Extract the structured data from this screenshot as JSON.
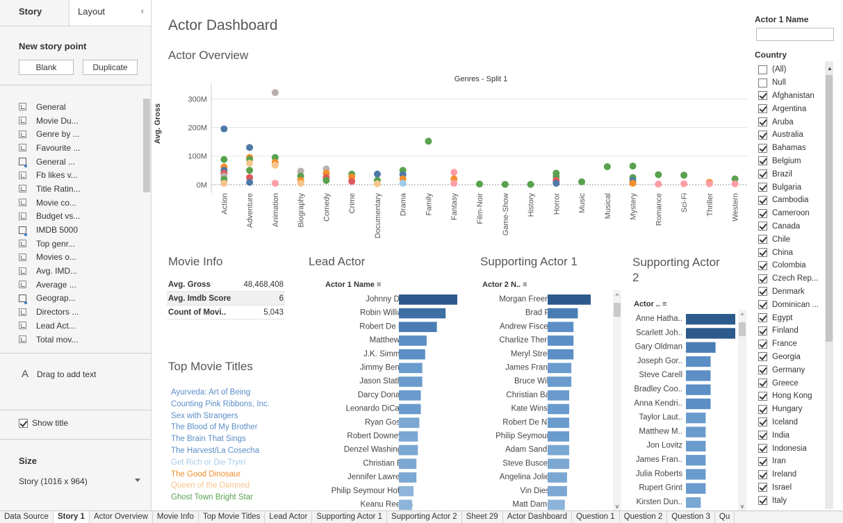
{
  "story_panel": {
    "tab_story": "Story",
    "tab_layout": "Layout",
    "new_story_point": "New story point",
    "blank_button": "Blank",
    "duplicate_button": "Duplicate",
    "sheets": [
      "General",
      "Movie Du...",
      "Genre by ...",
      "Favourite ...",
      "General ...",
      "Fb likes v...",
      "Title Ratin...",
      "Movie co...",
      "Budget vs...",
      "IMDB 5000",
      "Top genr...",
      "Movies o...",
      "Avg. IMD...",
      "Average ...",
      "Geograp...",
      "Directors ...",
      "Lead Act...",
      "Total mov..."
    ],
    "sheet_icons": [
      "chart",
      "chart",
      "chart",
      "chart",
      "dashboard",
      "chart",
      "chart",
      "chart",
      "chart",
      "dashboard",
      "chart",
      "chart",
      "chart",
      "chart",
      "dashboard",
      "chart",
      "chart",
      "chart"
    ],
    "drag_text": "Drag to add text",
    "show_title": "Show title",
    "size_label": "Size",
    "size_value": "Story (1016 x 964)"
  },
  "dashboard": {
    "title": "Actor Dashboard",
    "overview_title": "Actor Overview",
    "movie_info_title": "Movie Info",
    "lead_actor_title": "Lead Actor",
    "supporting1_title": "Supporting Actor 1",
    "supporting2_title": "Supporting Actor",
    "supporting2_title_line2": "2",
    "top_titles_title": "Top Movie Titles",
    "movie_info": [
      {
        "label": "Avg. Gross",
        "value": "48,468,408"
      },
      {
        "label": "Avg. Imdb Score",
        "value": "6"
      },
      {
        "label": "Count of Movi..",
        "value": "5,043"
      }
    ],
    "lead_header": "Actor 1 Name",
    "sup1_header": "Actor 2 N..",
    "sup2_header": "Actor ..",
    "top_titles": [
      {
        "text": "Ayurveda: Art of Being",
        "color": "#5b8ec7"
      },
      {
        "text": "Counting  Pink Ribbons, Inc.",
        "color": "#5b8ec7"
      },
      {
        "text": "Sex with Strangers",
        "color": "#5b8ec7"
      },
      {
        "text": "The Blood of My Brother",
        "color": "#5b8ec7"
      },
      {
        "text": "The Brain That Sings",
        "color": "#5b8ec7"
      },
      {
        "text": "The Harvest/La Cosecha",
        "color": "#5b8ec7"
      },
      {
        "text": "Get Rich or Die Tryin'",
        "color": "#a6cbe9"
      },
      {
        "text": "The Good Dinosaur",
        "color": "#f28e2b"
      },
      {
        "text": "Queen of the Damned",
        "color": "#f7c58b"
      },
      {
        "text": "Ghost Town  Bright Star",
        "color": "#59a14f"
      }
    ]
  },
  "filters": {
    "actor1_label": "Actor 1 Name",
    "country_label": "Country",
    "countries": [
      {
        "name": "(All)",
        "checked": false
      },
      {
        "name": "Null",
        "checked": false
      },
      {
        "name": "Afghanistan",
        "checked": true
      },
      {
        "name": "Argentina",
        "checked": true
      },
      {
        "name": "Aruba",
        "checked": true
      },
      {
        "name": "Australia",
        "checked": true
      },
      {
        "name": "Bahamas",
        "checked": true
      },
      {
        "name": "Belgium",
        "checked": true
      },
      {
        "name": "Brazil",
        "checked": true
      },
      {
        "name": "Bulgaria",
        "checked": true
      },
      {
        "name": "Cambodia",
        "checked": true
      },
      {
        "name": "Cameroon",
        "checked": true
      },
      {
        "name": "Canada",
        "checked": true
      },
      {
        "name": "Chile",
        "checked": true
      },
      {
        "name": "China",
        "checked": true
      },
      {
        "name": "Colombia",
        "checked": true
      },
      {
        "name": "Czech Rep...",
        "checked": true
      },
      {
        "name": "Denmark",
        "checked": true
      },
      {
        "name": "Dominican ...",
        "checked": true
      },
      {
        "name": "Egypt",
        "checked": true
      },
      {
        "name": "Finland",
        "checked": true
      },
      {
        "name": "France",
        "checked": true
      },
      {
        "name": "Georgia",
        "checked": true
      },
      {
        "name": "Germany",
        "checked": true
      },
      {
        "name": "Greece",
        "checked": true
      },
      {
        "name": "Hong Kong",
        "checked": true
      },
      {
        "name": "Hungary",
        "checked": true
      },
      {
        "name": "Iceland",
        "checked": true
      },
      {
        "name": "India",
        "checked": true
      },
      {
        "name": "Indonesia",
        "checked": true
      },
      {
        "name": "Iran",
        "checked": true
      },
      {
        "name": "Ireland",
        "checked": true
      },
      {
        "name": "Israel",
        "checked": true
      },
      {
        "name": "Italy",
        "checked": true
      }
    ]
  },
  "bottom_tabs": [
    {
      "label": "Data Source",
      "active": false
    },
    {
      "label": "Story 1",
      "active": true
    },
    {
      "label": "Actor Overview",
      "active": false
    },
    {
      "label": "Movie Info",
      "active": false
    },
    {
      "label": "Top Movie Titles",
      "active": false
    },
    {
      "label": "Lead Actor",
      "active": false
    },
    {
      "label": "Supporting Actor 1",
      "active": false
    },
    {
      "label": "Supporting Actor 2",
      "active": false
    },
    {
      "label": "Sheet 29",
      "active": false
    },
    {
      "label": "Actor Dashboard",
      "active": false
    },
    {
      "label": "Question 1",
      "active": false
    },
    {
      "label": "Question 2",
      "active": false
    },
    {
      "label": "Question 3",
      "active": false
    },
    {
      "label": "Qu",
      "active": false
    }
  ],
  "chart_data": [
    {
      "type": "scatter",
      "title": "Genres - Split 1",
      "ylabel": "Avg. Gross",
      "ylim": [
        -10000000,
        330000000
      ],
      "yticks": [
        "0M",
        "100M",
        "200M",
        "300M"
      ],
      "ytick_values": [
        0,
        100000000,
        200000000,
        300000000
      ],
      "categories": [
        "Action",
        "Adventure",
        "Animation",
        "Biography",
        "Comedy",
        "Crime",
        "Documentary",
        "Drama",
        "Family",
        "Fantasy",
        "Film-Noir",
        "Game-Show",
        "History",
        "Horror",
        "Music",
        "Musical",
        "Mystery",
        "Romance",
        "Sci-Fi",
        "Thriller",
        "Western"
      ],
      "points": [
        {
          "x": "Action",
          "y": 195000000,
          "color": "#4e79a7"
        },
        {
          "x": "Action",
          "y": 88000000,
          "color": "#59a14f"
        },
        {
          "x": "Action",
          "y": 62000000,
          "color": "#f28e2b"
        },
        {
          "x": "Action",
          "y": 50000000,
          "color": "#4e79a7"
        },
        {
          "x": "Action",
          "y": 40000000,
          "color": "#e15759"
        },
        {
          "x": "Action",
          "y": 30000000,
          "color": "#bab0ac"
        },
        {
          "x": "Action",
          "y": 18000000,
          "color": "#59a14f"
        },
        {
          "x": "Action",
          "y": 5000000,
          "color": "#f7c58b"
        },
        {
          "x": "Adventure",
          "y": 130000000,
          "color": "#4e79a7"
        },
        {
          "x": "Adventure",
          "y": 95000000,
          "color": "#f28e2b"
        },
        {
          "x": "Adventure",
          "y": 88000000,
          "color": "#59a14f"
        },
        {
          "x": "Adventure",
          "y": 75000000,
          "color": "#f7c58b"
        },
        {
          "x": "Adventure",
          "y": 50000000,
          "color": "#59a14f"
        },
        {
          "x": "Adventure",
          "y": 25000000,
          "color": "#e15759"
        },
        {
          "x": "Adventure",
          "y": 8000000,
          "color": "#4e79a7"
        },
        {
          "x": "Animation",
          "y": 322000000,
          "color": "#bab0ac"
        },
        {
          "x": "Animation",
          "y": 95000000,
          "color": "#59a14f"
        },
        {
          "x": "Animation",
          "y": 78000000,
          "color": "#f28e2b"
        },
        {
          "x": "Animation",
          "y": 68000000,
          "color": "#f7c58b"
        },
        {
          "x": "Animation",
          "y": 5000000,
          "color": "#ff9da7"
        },
        {
          "x": "Biography",
          "y": 47000000,
          "color": "#bab0ac"
        },
        {
          "x": "Biography",
          "y": 30000000,
          "color": "#59a14f"
        },
        {
          "x": "Biography",
          "y": 15000000,
          "color": "#f28e2b"
        },
        {
          "x": "Biography",
          "y": 5000000,
          "color": "#f7c58b"
        },
        {
          "x": "Comedy",
          "y": 55000000,
          "color": "#bab0ac"
        },
        {
          "x": "Comedy",
          "y": 40000000,
          "color": "#f28e2b"
        },
        {
          "x": "Comedy",
          "y": 25000000,
          "color": "#e15759"
        },
        {
          "x": "Comedy",
          "y": 15000000,
          "color": "#59a14f"
        },
        {
          "x": "Crime",
          "y": 37000000,
          "color": "#59a14f"
        },
        {
          "x": "Crime",
          "y": 27000000,
          "color": "#f28e2b"
        },
        {
          "x": "Crime",
          "y": 12000000,
          "color": "#e15759"
        },
        {
          "x": "Documentary",
          "y": 37000000,
          "color": "#4e79a7"
        },
        {
          "x": "Documentary",
          "y": 15000000,
          "color": "#59a14f"
        },
        {
          "x": "Documentary",
          "y": 3000000,
          "color": "#f7c58b"
        },
        {
          "x": "Drama",
          "y": 50000000,
          "color": "#59a14f"
        },
        {
          "x": "Drama",
          "y": 35000000,
          "color": "#4e79a7"
        },
        {
          "x": "Drama",
          "y": 20000000,
          "color": "#f28e2b"
        },
        {
          "x": "Drama",
          "y": 5000000,
          "color": "#a0cbe8"
        },
        {
          "x": "Family",
          "y": 152000000,
          "color": "#59a14f"
        },
        {
          "x": "Fantasy",
          "y": 43000000,
          "color": "#ff9da7"
        },
        {
          "x": "Fantasy",
          "y": 20000000,
          "color": "#f28e2b"
        },
        {
          "x": "Fantasy",
          "y": 5000000,
          "color": "#ff9da7"
        },
        {
          "x": "Film-Noir",
          "y": 2000000,
          "color": "#59a14f"
        },
        {
          "x": "Game-Show",
          "y": 1000000,
          "color": "#59a14f"
        },
        {
          "x": "History",
          "y": 1000000,
          "color": "#59a14f"
        },
        {
          "x": "Horror",
          "y": 40000000,
          "color": "#59a14f"
        },
        {
          "x": "Horror",
          "y": 28000000,
          "color": "#59a14f"
        },
        {
          "x": "Horror",
          "y": 15000000,
          "color": "#e15759"
        },
        {
          "x": "Horror",
          "y": 5000000,
          "color": "#4e79a7"
        },
        {
          "x": "Music",
          "y": 10000000,
          "color": "#59a14f"
        },
        {
          "x": "Musical",
          "y": 63000000,
          "color": "#59a14f"
        },
        {
          "x": "Mystery",
          "y": 65000000,
          "color": "#59a14f"
        },
        {
          "x": "Mystery",
          "y": 25000000,
          "color": "#59a14f"
        },
        {
          "x": "Mystery",
          "y": 15000000,
          "color": "#4e79a7"
        },
        {
          "x": "Mystery",
          "y": 5000000,
          "color": "#f28e2b"
        },
        {
          "x": "Romance",
          "y": 35000000,
          "color": "#59a14f"
        },
        {
          "x": "Romance",
          "y": 2000000,
          "color": "#ff9da7"
        },
        {
          "x": "Sci-Fi",
          "y": 33000000,
          "color": "#59a14f"
        },
        {
          "x": "Sci-Fi",
          "y": 3000000,
          "color": "#ff9da7"
        },
        {
          "x": "Thriller",
          "y": 8000000,
          "color": "#f28e2b"
        },
        {
          "x": "Thriller",
          "y": 3000000,
          "color": "#ff9da7"
        },
        {
          "x": "Western",
          "y": 20000000,
          "color": "#59a14f"
        },
        {
          "x": "Western",
          "y": 3000000,
          "color": "#ff9da7"
        }
      ]
    },
    {
      "type": "bar",
      "title": "Lead Actor",
      "categories": [
        "Johnny Depp",
        "Robin Williams",
        "Robert De Niro",
        "Matthew Ziff",
        "J.K. Simmons",
        "Jimmy Bennett",
        "Jason Statham",
        "Darcy Donavan",
        "Leonardo DiCaprio",
        "Ryan Gosling",
        "Robert Downey Jr.",
        "Denzel Washington",
        "Christian Bale",
        "Jennifer Lawrence",
        "Philip Seymour Hoffm..",
        "Keanu Reeves"
      ],
      "values": [
        40,
        32,
        26,
        19,
        18,
        16,
        16,
        15,
        15,
        14,
        13,
        13,
        12,
        12,
        10,
        9
      ],
      "colors": [
        "#2d5a8c",
        "#3d6fa3",
        "#4a7db3",
        "#5b8fc5",
        "#5b8fc5",
        "#6a9bcd",
        "#6a9bcd",
        "#6a9bcd",
        "#6a9bcd",
        "#7ba7d3",
        "#7ba7d3",
        "#7ba7d3",
        "#7ba7d3",
        "#7ba7d3",
        "#8db4da",
        "#8db4da"
      ]
    },
    {
      "type": "bar",
      "title": "Supporting Actor 1",
      "categories": [
        "Morgan Freem..",
        "Brad Pitt",
        "Andrew Fiscella",
        "Charlize Theron",
        "Meryl Streep",
        "James Franco",
        "Bruce Willis",
        "Christian Bale",
        "Kate Winslet",
        "Robert De Niro",
        "Philip Seymour ..",
        "Adam Sandler",
        "Steve Buscemi",
        "Angelina Jolie ..",
        "Vin Diesel",
        "Matt Damon"
      ],
      "values": [
        20,
        14,
        12,
        12,
        12,
        11,
        11,
        10,
        10,
        10,
        10,
        10,
        10,
        9,
        9,
        8
      ],
      "colors": [
        "#2d5a8c",
        "#4a7db3",
        "#5b8fc5",
        "#5b8fc5",
        "#5b8fc5",
        "#6a9bcd",
        "#6a9bcd",
        "#6a9bcd",
        "#6a9bcd",
        "#6a9bcd",
        "#6a9bcd",
        "#7ba7d3",
        "#7ba7d3",
        "#7ba7d3",
        "#7ba7d3",
        "#8db4da"
      ]
    },
    {
      "type": "bar",
      "title": "Supporting Actor 2",
      "categories": [
        "Anne Hatha..",
        "Scarlett Joh..",
        "Gary Oldman",
        "Joseph Gor..",
        "Steve Carell",
        "Bradley Coo..",
        "Anna Kendri..",
        "Taylor Laut..",
        "Matthew M..",
        "Jon Lovitz",
        "James Fran..",
        "Julia Roberts",
        "Rupert Grint",
        "Kirsten Dun.."
      ],
      "values": [
        10,
        10,
        6,
        5,
        5,
        5,
        5,
        4,
        4,
        4,
        4,
        4,
        4,
        3
      ],
      "colors": [
        "#2d5a8c",
        "#2d5a8c",
        "#4a7db3",
        "#5b8fc5",
        "#5b8fc5",
        "#5b8fc5",
        "#5b8fc5",
        "#6a9bcd",
        "#6a9bcd",
        "#6a9bcd",
        "#6a9bcd",
        "#6a9bcd",
        "#6a9bcd",
        "#7ba7d3"
      ]
    }
  ]
}
